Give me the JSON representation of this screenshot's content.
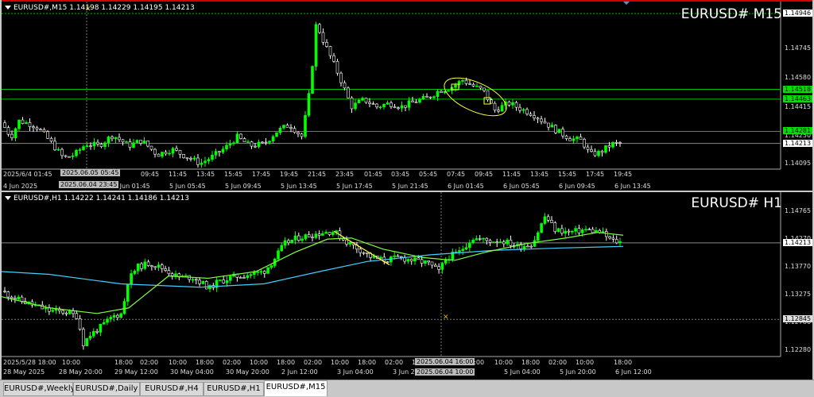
{
  "top_chart": {
    "header": "EURUSD#,M15  1.14198 1.14229 1.14195 1.14213",
    "title": "EURUSD# M15",
    "price_ticks": [
      "1.14946",
      "1.14745",
      "1.14580",
      "1.14415",
      "1.14250",
      "1.14095"
    ],
    "price_tags": [
      {
        "value": "1.14946",
        "color": "#ffffff"
      },
      {
        "value": "1.14518",
        "color": "#00e000"
      },
      {
        "value": "1.14463",
        "color": "#00e000"
      },
      {
        "value": "1.14281",
        "color": "#00e000"
      },
      {
        "value": "1.14213",
        "color": "#ffffff"
      }
    ],
    "time_ticks": [
      "2025/6/4 01:45",
      "07:45",
      "09:45",
      "11:45",
      "13:45",
      "15:45",
      "17:45",
      "19:45",
      "21:45",
      "23:45",
      "01:45",
      "03:45",
      "05:45",
      "07:45",
      "09:45",
      "11:45",
      "13:45",
      "15:45",
      "17:45",
      "19:45"
    ],
    "date_ticks": [
      "4 Jun 2025",
      "5 Jun 01:45",
      "5 Jun 05:45",
      "5 Jun 09:45",
      "5 Jun 13:45",
      "5 Jun 17:45",
      "5 Jun 21:45",
      "6 Jun 01:45",
      "6 Jun 05:45",
      "6 Jun 09:45",
      "6 Jun 13:45"
    ],
    "crosshair_labels": [
      "2025.06.05 05:45",
      "2025.06.04 23:45"
    ]
  },
  "bottom_chart": {
    "header": "EURUSD#,H1  1.14222 1.14241 1.14186 1.14213",
    "title": "EURUSD# H1",
    "price_ticks": [
      "1.14765",
      "1.14270",
      "1.13770",
      "1.13275",
      "1.12780",
      "1.12280"
    ],
    "price_tags": [
      {
        "value": "1.14213",
        "color": "#ffffff"
      },
      {
        "value": "1.12845",
        "color": "#dddddd"
      }
    ],
    "time_ticks": [
      "2025/5/28 18:00",
      "10:00",
      "18:00",
      "02:00",
      "10:00",
      "18:00",
      "02:00",
      "10:00",
      "18:00",
      "02:00",
      "10:00",
      "18:00",
      "02:00",
      "10:00",
      "18:00",
      "02:00",
      "10:00",
      "18:00",
      "02:00",
      "10:00",
      "18:00"
    ],
    "date_ticks": [
      "28 May 2025",
      "28 May 20:00",
      "29 May 12:00",
      "30 May 04:00",
      "30 May 20:00",
      "2 Jun 12:00",
      "3 Jun 04:00",
      "3 Jun 20:00",
      "4 Jun 12:00",
      "5 Jun 04:00",
      "5 Jun 20:00",
      "6 Jun 12:00"
    ],
    "crosshair_labels": [
      "2025.06.04 16:00",
      "2025.06.04 10:00"
    ]
  },
  "tabs": [
    {
      "label": "EURUSD#,Weekly",
      "active": false
    },
    {
      "label": "EURUSD#,Daily",
      "active": false
    },
    {
      "label": "EURUSD#,H4",
      "active": false
    },
    {
      "label": "EURUSD#,H1",
      "active": false
    },
    {
      "label": "EURUSD#,M15",
      "active": true
    }
  ],
  "colors": {
    "bull": "#00ff00",
    "bear": "#ffffff",
    "ma_fast": "#7fff3f",
    "ma_slow": "#40d0ff",
    "annotation": "#ffff3f",
    "level": "#00c000"
  }
}
